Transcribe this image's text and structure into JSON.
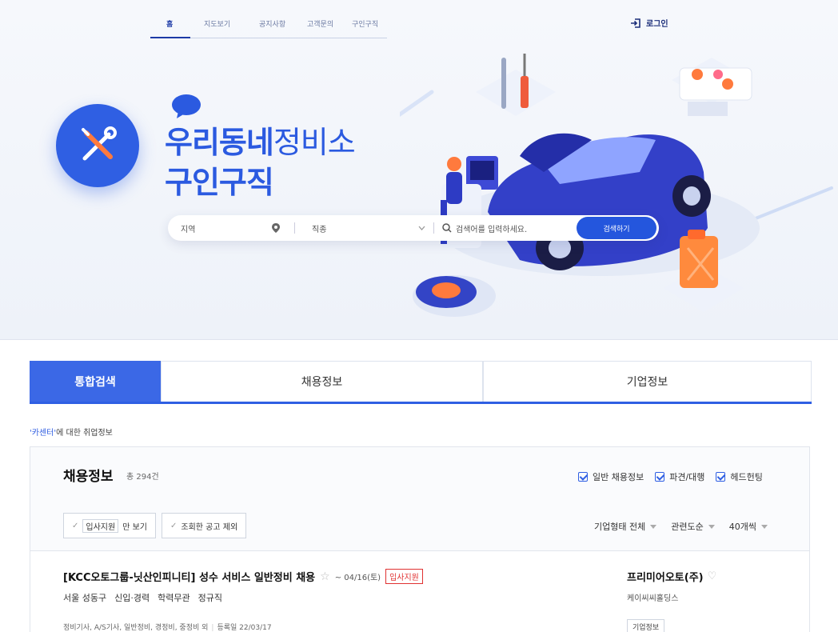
{
  "nav": {
    "items": [
      {
        "label": "홈",
        "active": true
      },
      {
        "label": "지도보기"
      },
      {
        "label": "공지사항"
      },
      {
        "label": "고객문의"
      },
      {
        "label": "구인구직"
      }
    ],
    "login_label": "로그인"
  },
  "hero": {
    "title_strong": "우리동네",
    "title_thin": "정비소",
    "title_line2": "구인구직"
  },
  "search": {
    "region_placeholder": "지역",
    "job_placeholder": "직종",
    "keyword_placeholder": "검색어를 입력하세요.",
    "button_label": "검색하기"
  },
  "tabs": [
    {
      "label": "통합검색",
      "active": true
    },
    {
      "label": "채용정보"
    },
    {
      "label": "기업정보"
    }
  ],
  "results": {
    "keyword": "'카센터'",
    "caption_rest": "에 대한 취업정보"
  },
  "panel": {
    "title": "채용정보",
    "count": "총 294건",
    "checks": [
      "일반 채용정보",
      "파견/대행",
      "헤드헌팅"
    ],
    "filter1_boxed": "입사지원",
    "filter1_rest": "만 보기",
    "filter2": "조회한 공고 제외",
    "sorts": [
      "기업형태 전체",
      "관련도순",
      "40개씩"
    ]
  },
  "jobs": [
    {
      "title": "[KCC오토그룹-닛산인피니티] 성수 서비스 일반정비 채용",
      "deadline": "~ 04/16(토)",
      "apply_badge": "입사지원",
      "meta": [
        "서울 성동구",
        "신입·경력",
        "학력무관",
        "정규직"
      ],
      "sub": "정비기사, A/S기사, 일반정비, 경정비, 중정비 외",
      "registered": "등록일 22/03/17",
      "company": "프리미어오토(주)",
      "company_sub": "케이씨씨홀딩스",
      "company_btn": "기업정보"
    }
  ],
  "colors": {
    "brand": "#2b5ae0",
    "tab_active": "#3b68e6",
    "apply_red": "#e03131"
  }
}
